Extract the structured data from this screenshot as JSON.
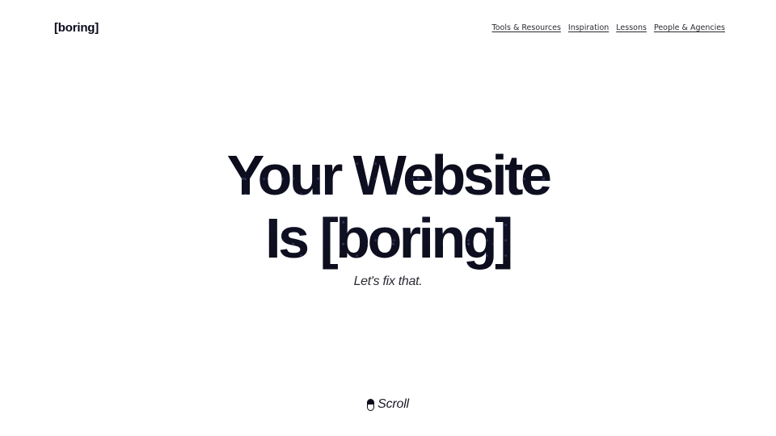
{
  "header": {
    "logo": "[boring]",
    "nav": [
      {
        "label": "Tools & Resources"
      },
      {
        "label": "Inspiration"
      },
      {
        "label": "Lessons"
      },
      {
        "label": "People & Agencies"
      }
    ]
  },
  "hero": {
    "headline_line1": "Your Website",
    "headline_line2": "Is [boring]",
    "subline": "Let's fix that."
  },
  "scroll": {
    "icon": "mouse-icon",
    "label": "Scroll"
  },
  "colors": {
    "background": "#ffffff",
    "text": "#0b0b1c"
  }
}
